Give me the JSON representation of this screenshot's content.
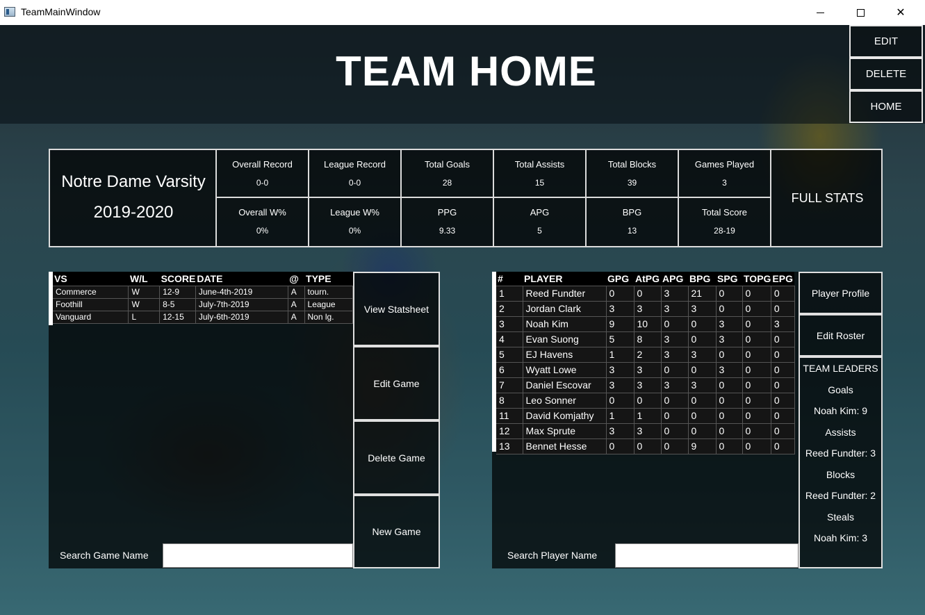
{
  "window": {
    "title": "TeamMainWindow"
  },
  "header": {
    "title": "TEAM HOME"
  },
  "side_buttons": {
    "edit": "EDIT",
    "delete": "DELETE",
    "home": "HOME"
  },
  "team": {
    "name": "Notre Dame Varsity",
    "season": "2019-2020"
  },
  "stats": [
    {
      "label": "Overall Record",
      "value": "0-0"
    },
    {
      "label": "League Record",
      "value": "0-0"
    },
    {
      "label": "Total Goals",
      "value": "28"
    },
    {
      "label": "Total Assists",
      "value": "15"
    },
    {
      "label": "Total Blocks",
      "value": "39"
    },
    {
      "label": "Games Played",
      "value": "3"
    },
    {
      "label": "Overall W%",
      "value": "0%"
    },
    {
      "label": "League W%",
      "value": "0%"
    },
    {
      "label": "PPG",
      "value": "9.33"
    },
    {
      "label": "APG",
      "value": "5"
    },
    {
      "label": "BPG",
      "value": "13"
    },
    {
      "label": "Total Score",
      "value": "28-19"
    }
  ],
  "full_stats_label": "FULL STATS",
  "games": {
    "columns": [
      "VS",
      "W/L",
      "SCORE",
      "DATE",
      "@",
      "TYPE"
    ],
    "rows": [
      [
        "Commerce",
        "W",
        "12-9",
        "June-4th-2019",
        "A",
        "tourn."
      ],
      [
        "Foothill",
        "W",
        "8-5",
        "July-7th-2019",
        "A",
        "League"
      ],
      [
        "Vanguard",
        "L",
        "12-15",
        "July-6th-2019",
        "A",
        "Non lg."
      ]
    ],
    "search_label": "Search Game Name",
    "search_value": ""
  },
  "game_buttons": {
    "view": "View Statsheet",
    "edit": "Edit Game",
    "delete": "Delete Game",
    "new": "New Game"
  },
  "players": {
    "columns": [
      "#",
      "PLAYER",
      "GPG",
      "AtPG",
      "APG",
      "BPG",
      "SPG",
      "TOPG",
      "EPG"
    ],
    "rows": [
      [
        "1",
        "Reed Fundter",
        "0",
        "0",
        "3",
        "21",
        "0",
        "0",
        "0"
      ],
      [
        "2",
        "Jordan Clark",
        "3",
        "3",
        "3",
        "3",
        "0",
        "0",
        "0"
      ],
      [
        "3",
        "Noah Kim",
        "9",
        "10",
        "0",
        "0",
        "3",
        "0",
        "3"
      ],
      [
        "4",
        "Evan Suong",
        "5",
        "8",
        "3",
        "0",
        "3",
        "0",
        "0"
      ],
      [
        "5",
        "EJ Havens",
        "1",
        "2",
        "3",
        "3",
        "0",
        "0",
        "0"
      ],
      [
        "6",
        "Wyatt Lowe",
        "3",
        "3",
        "0",
        "0",
        "3",
        "0",
        "0"
      ],
      [
        "7",
        "Daniel Escovar",
        "3",
        "3",
        "3",
        "3",
        "0",
        "0",
        "0"
      ],
      [
        "8",
        "Leo Sonner",
        "0",
        "0",
        "0",
        "0",
        "0",
        "0",
        "0"
      ],
      [
        "11",
        "David Komjathy",
        "1",
        "1",
        "0",
        "0",
        "0",
        "0",
        "0"
      ],
      [
        "12",
        "Max Sprute",
        "3",
        "3",
        "0",
        "0",
        "0",
        "0",
        "0"
      ],
      [
        "13",
        "Bennet Hesse",
        "0",
        "0",
        "0",
        "9",
        "0",
        "0",
        "0"
      ]
    ],
    "search_label": "Search Player Name",
    "search_value": ""
  },
  "player_buttons": {
    "profile": "Player Profile",
    "roster": "Edit Roster"
  },
  "leaders": {
    "title": "TEAM LEADERS",
    "goals_label": "Goals",
    "goals_value": "Noah Kim: 9",
    "assists_label": "Assists",
    "assists_value": "Reed Fundter: 3",
    "blocks_label": "Blocks",
    "blocks_value": "Reed Fundter: 2",
    "steals_label": "Steals",
    "steals_value": "Noah Kim: 3"
  }
}
